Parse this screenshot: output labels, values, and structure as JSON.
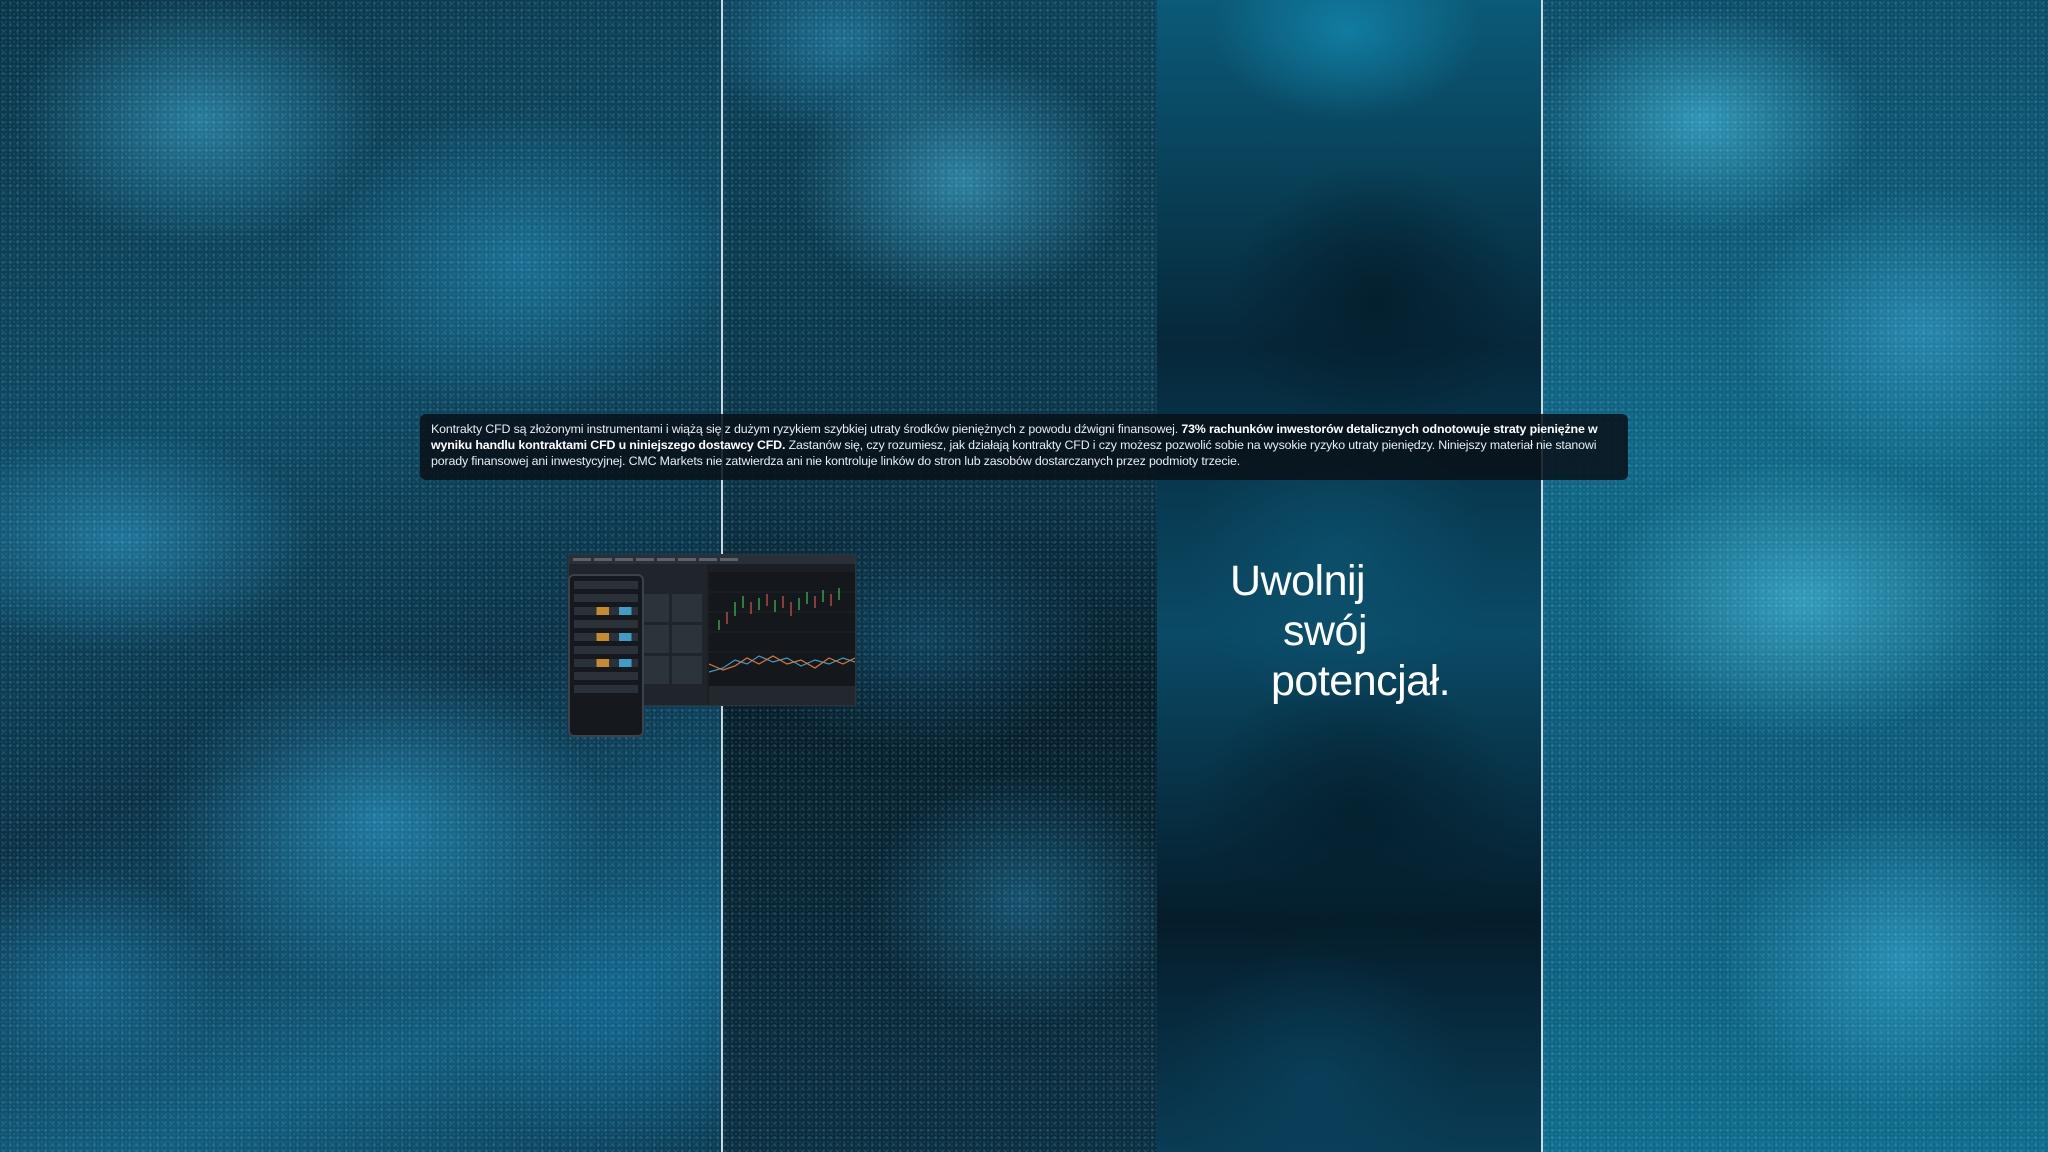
{
  "disclaimer": {
    "text_1": "Kontrakty CFD są złożonymi instrumentami i wiążą się z dużym ryzykiem szybkiej utraty środków pieniężnych z powodu dźwigni finansowej. ",
    "bold": "73% rachunków inwestorów detalicznych odnotowuje straty pieniężne w wyniku handlu kontraktami CFD u niniejszego dostawcy CFD.",
    "text_2": " Zastanów się, czy rozumiesz, jak działają kontrakty CFD i czy możesz pozwolić sobie na wysokie ryzyko utraty pieniędzy. Niniejszy materiał nie stanowi porady finansowej ani inwestycyjnej. CMC Markets nie zatwierdza ani nie kontroluje linków do stron lub zasobów dostarczanych przez podmioty trzecie."
  },
  "headline": {
    "line1": "Uwolnij",
    "line2": "swój",
    "line3": "potencjał."
  },
  "colors": {
    "accent": "#0e6a8a",
    "divider": "#ebf5fa",
    "text": "#ffffff"
  },
  "mockup": {
    "icon": "trading-platform-screenshot"
  }
}
